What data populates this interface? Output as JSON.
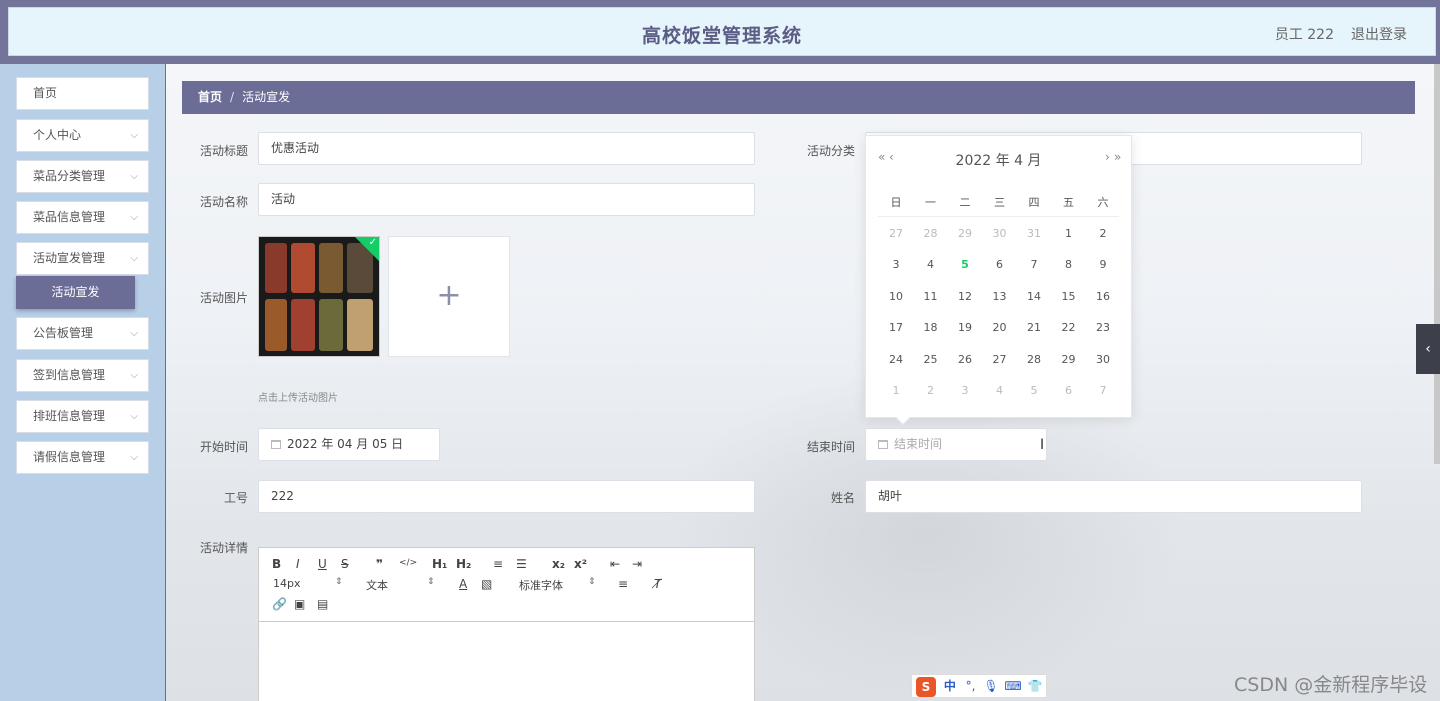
{
  "header": {
    "title": "高校饭堂管理系统",
    "user": "员工 222",
    "logout": "退出登录"
  },
  "sidebar": {
    "items": [
      {
        "label": "首页",
        "has_children": false
      },
      {
        "label": "个人中心",
        "has_children": true
      },
      {
        "label": "菜品分类管理",
        "has_children": true
      },
      {
        "label": "菜品信息管理",
        "has_children": true
      },
      {
        "label": "活动宣发管理",
        "has_children": true
      },
      {
        "label": "公告板管理",
        "has_children": true
      },
      {
        "label": "签到信息管理",
        "has_children": true
      },
      {
        "label": "排班信息管理",
        "has_children": true
      },
      {
        "label": "请假信息管理",
        "has_children": true
      }
    ],
    "active_sub": "活动宣发",
    "chevron": "⌵"
  },
  "breadcrumb": {
    "home": "首页",
    "separator": "/",
    "current": "活动宣发"
  },
  "form": {
    "title_label": "活动标题",
    "title_value": "优惠活动",
    "category_label": "活动分类",
    "name_label": "活动名称",
    "name_value": "活动",
    "image_label": "活动图片",
    "upload_hint": "点击上传活动图片",
    "upload_plus": "+",
    "start_label": "开始时间",
    "start_value": "2022 年 04 月 05 日",
    "end_label": "结束时间",
    "end_placeholder": "结束时间",
    "empno_label": "工号",
    "empno_value": "222",
    "name2_label": "姓名",
    "name2_value": "胡叶",
    "details_label": "活动详情"
  },
  "editor": {
    "toolbar_row1": [
      "B",
      "I",
      "U",
      "S",
      "❞",
      "</>",
      "H₁",
      "H₂",
      "≡",
      "☰",
      "x₂",
      "x²",
      "⇤",
      "⇥"
    ],
    "font_size": "14px",
    "text_type": "文本",
    "font_family": "标准字体",
    "toolbar_row2_icons": [
      "text-color-icon",
      "bg-color-icon",
      "align-icon",
      "clear-format-icon"
    ],
    "toolbar_row3_icons": [
      "link-icon",
      "image-icon",
      "video-icon"
    ]
  },
  "datepicker": {
    "header": "2022 年  4 月",
    "prev_year": "«",
    "prev_month": "‹",
    "next_month": "›",
    "next_year": "»",
    "weekdays": [
      "日",
      "一",
      "二",
      "三",
      "四",
      "五",
      "六"
    ],
    "weeks": [
      [
        "27",
        "28",
        "29",
        "30",
        "31",
        "1",
        "2"
      ],
      [
        "3",
        "4",
        "5",
        "6",
        "7",
        "8",
        "9"
      ],
      [
        "10",
        "11",
        "12",
        "13",
        "14",
        "15",
        "16"
      ],
      [
        "17",
        "18",
        "19",
        "20",
        "21",
        "22",
        "23"
      ],
      [
        "24",
        "25",
        "26",
        "27",
        "28",
        "29",
        "30"
      ],
      [
        "1",
        "2",
        "3",
        "4",
        "5",
        "6",
        "7"
      ]
    ],
    "today": "5",
    "today_color": "#13ce66"
  },
  "ime": {
    "logo": "S",
    "mode": "中"
  },
  "watermark": "CSDN @金新程序毕设",
  "colors": {
    "accent": "#6b6d96",
    "sidebar": "#b8cfe8",
    "header_bg": "#e6f4fb"
  }
}
